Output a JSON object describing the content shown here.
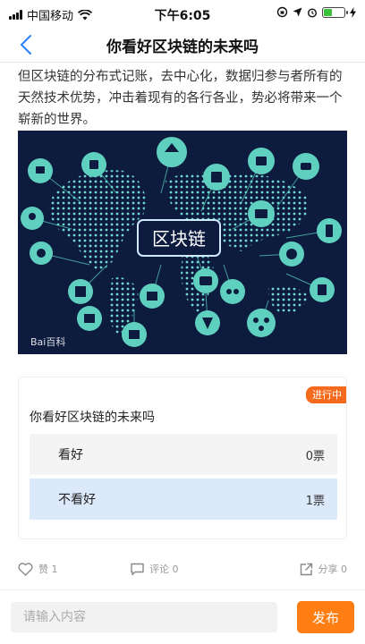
{
  "status_bar": {
    "carrier": "中国移动",
    "time": "下午6:05"
  },
  "header": {
    "title": "你看好区块链的未来吗"
  },
  "article": {
    "text": "但区块链的分布式记账，去中心化，数据归参与者所有的天然技术优势，冲击着现有的各行各业，势必将带来一个崭新的世界。"
  },
  "hero_image": {
    "center_label": "区块链",
    "watermark": "Bai百科",
    "colors": {
      "background": "#0d1b3e",
      "node": "#5fd0c0",
      "dots": "#6fd8d0"
    }
  },
  "poll": {
    "status_badge": "进行中",
    "question": "你看好区块链的未来吗",
    "options": [
      {
        "label": "看好",
        "votes": "0票"
      },
      {
        "label": "不看好",
        "votes": "1票"
      }
    ]
  },
  "actions": {
    "like": "赞 1",
    "comment": "评论 0",
    "share": "分享 0"
  },
  "comment_bar": {
    "placeholder": "请输入内容",
    "publish_label": "发布"
  },
  "colors": {
    "accent": "#fe7e13",
    "badge": "#f56b1e",
    "selected_option": "#dce9fb"
  }
}
